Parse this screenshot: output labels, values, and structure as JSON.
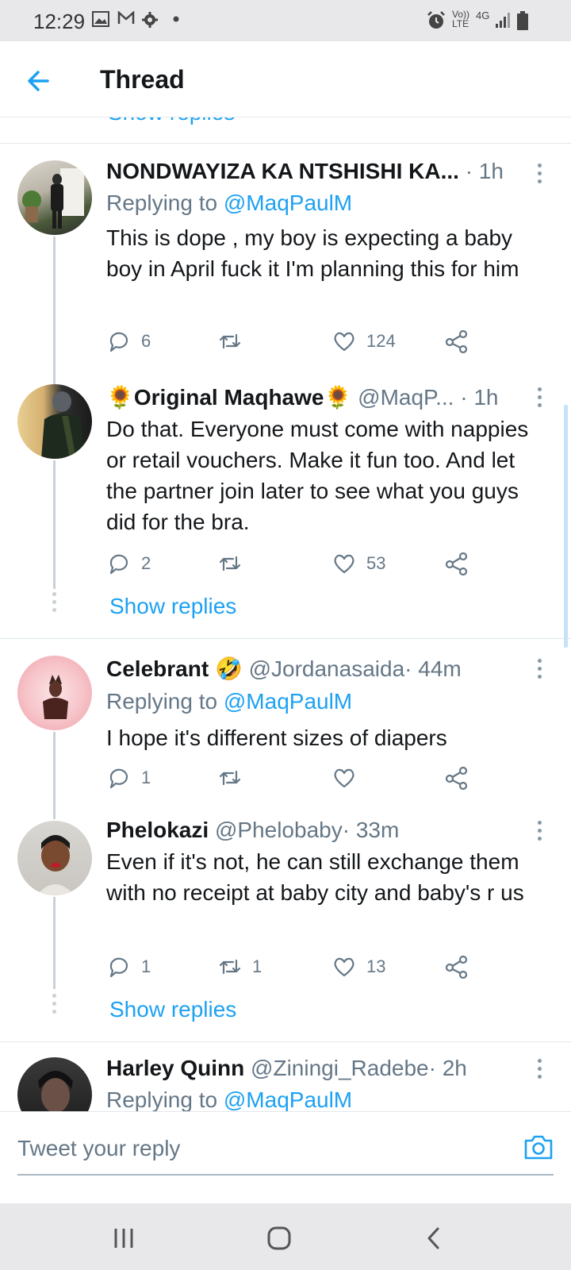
{
  "status_bar": {
    "time": "12:29",
    "left_icons": [
      "image-icon",
      "gmail-icon",
      "gear-icon",
      "dot-icon"
    ],
    "right_icons": [
      "alarm-icon",
      "volte-icon",
      "4g-icon",
      "signal-icon",
      "battery-icon"
    ],
    "volte": "Vo)) LTE",
    "network": "4G"
  },
  "header": {
    "title": "Thread"
  },
  "partial_show_replies": "Show replies",
  "tweets": [
    {
      "name": "NONDWAYIZA KA NTSHISHI KA...",
      "handle": "",
      "time": "· 1h",
      "replying_to_prefix": "Replying to ",
      "replying_to": "@MaqPaulM",
      "text": "This is dope , my boy is expecting a baby boy in April fuck it I'm planning this for him",
      "replies": "6",
      "retweets": "",
      "likes": "124"
    },
    {
      "name_prefix_emoji": "🌻",
      "name": "Original Maqhawe",
      "name_suffix_emoji": "🌻",
      "handle": "@MaqP...",
      "time": "· 1h",
      "text": "Do that. Everyone must come with nappies or retail vouchers. Make it fun too. And let the partner join later to see what you guys did for the bra.",
      "replies": "2",
      "retweets": "",
      "likes": "53",
      "show_replies": "Show replies"
    },
    {
      "name": "Celebrant",
      "name_suffix_emoji": "🤣",
      "handle": "@Jordanasaida",
      "time": "· 44m",
      "replying_to_prefix": "Replying to ",
      "replying_to": "@MaqPaulM",
      "text": "I hope it's different sizes of diapers",
      "replies": "1",
      "retweets": "",
      "likes": ""
    },
    {
      "name": "Phelokazi",
      "handle": "@Phelobaby",
      "time": "· 33m",
      "text": "Even if it's not, he can still exchange them with no receipt at baby city and baby's r us",
      "replies": "1",
      "retweets": "1",
      "likes": "13",
      "show_replies": "Show replies"
    },
    {
      "name": "Harley Quinn",
      "handle": "@Ziningi_Radebe",
      "time": "· 2h",
      "replying_to_prefix": "Replying to ",
      "replying_to": "@MaqPaulM"
    }
  ],
  "reply_bar": {
    "placeholder": "Tweet your reply"
  },
  "colors": {
    "accent": "#1da1f2",
    "text": "#14171a",
    "secondary": "#657786",
    "divider": "#e1e8ed",
    "system_bar": "#e8e8ea"
  }
}
